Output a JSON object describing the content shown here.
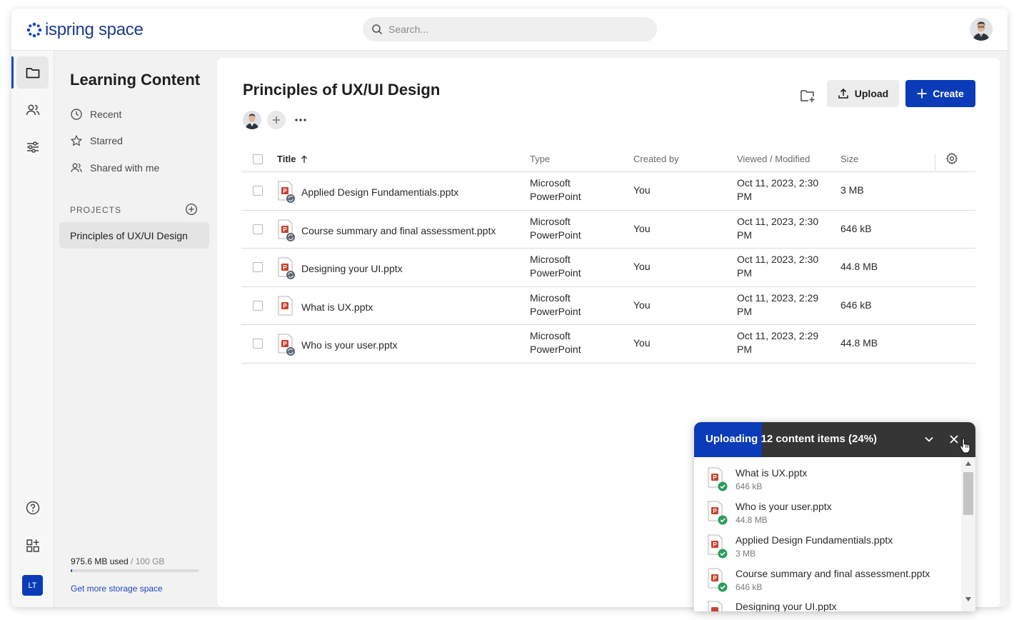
{
  "header": {
    "logo_text": "ispring space",
    "search_placeholder": "Search..."
  },
  "nav": {
    "title": "Learning Content",
    "items": [
      {
        "label": "Recent",
        "icon": "clock-icon"
      },
      {
        "label": "Starred",
        "icon": "star-icon"
      },
      {
        "label": "Shared with me",
        "icon": "people-icon"
      }
    ],
    "projects_label": "PROJECTS",
    "projects": [
      {
        "label": "Principles of UX/UI Design"
      }
    ],
    "storage": {
      "used": "975.6 MB used",
      "total": " / 100 GB",
      "fraction_used": 0.01,
      "link": "Get more storage space"
    }
  },
  "rail": {
    "user_initials": "LT"
  },
  "main": {
    "title": "Principles of UX/UI Design",
    "more_label": "•••",
    "upload_label": "Upload",
    "create_label": "Create"
  },
  "table": {
    "columns": [
      "Title",
      "Type",
      "Created by",
      "Viewed / Modified",
      "Size"
    ],
    "rows": [
      {
        "title": "Applied Design Fundamentials.pptx",
        "type_line1": "Microsoft",
        "type_line2": "PowerPoint",
        "created_by": "You",
        "modified_line1": "Oct 11, 2023, 2:30",
        "modified_line2": "PM",
        "size": "3 MB",
        "syncing": true
      },
      {
        "title": "Course summary and final assessment.pptx",
        "type_line1": "Microsoft",
        "type_line2": "PowerPoint",
        "created_by": "You",
        "modified_line1": "Oct 11, 2023, 2:30",
        "modified_line2": "PM",
        "size": "646 kB",
        "syncing": true
      },
      {
        "title": "Designing your UI.pptx",
        "type_line1": "Microsoft",
        "type_line2": "PowerPoint",
        "created_by": "You",
        "modified_line1": "Oct 11, 2023, 2:30",
        "modified_line2": "PM",
        "size": "44.8 MB",
        "syncing": true
      },
      {
        "title": "What is UX.pptx",
        "type_line1": "Microsoft",
        "type_line2": "PowerPoint",
        "created_by": "You",
        "modified_line1": "Oct 11, 2023, 2:29",
        "modified_line2": "PM",
        "size": "646 kB",
        "syncing": false
      },
      {
        "title": "Who is your user.pptx",
        "type_line1": "Microsoft",
        "type_line2": "PowerPoint",
        "created_by": "You",
        "modified_line1": "Oct 11, 2023, 2:29",
        "modified_line2": "PM",
        "size": "44.8 MB",
        "syncing": true
      }
    ]
  },
  "upload_panel": {
    "title": "Uploading 12 content items (24%)",
    "progress": 0.24,
    "items": [
      {
        "name": "What is UX.pptx",
        "size": "646 kB"
      },
      {
        "name": "Who is your user.pptx",
        "size": "44.8 MB"
      },
      {
        "name": "Applied Design Fundamentials.pptx",
        "size": "3 MB"
      },
      {
        "name": "Course summary and final assessment.pptx",
        "size": "646 kB"
      },
      {
        "name": "Designing your UI.pptx",
        "size": ""
      }
    ]
  },
  "colors": {
    "brand": "#0b3bb8",
    "ppt": "#c8442f",
    "success": "#2a9d5c"
  }
}
